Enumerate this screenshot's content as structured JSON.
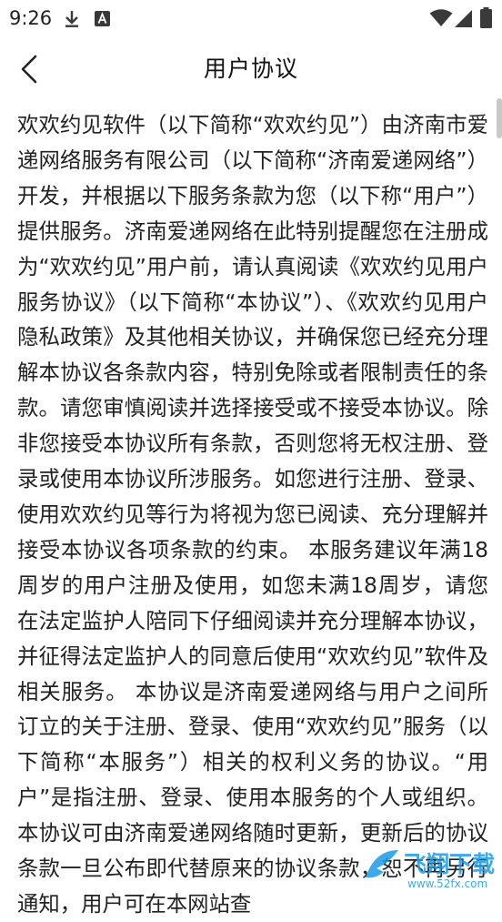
{
  "status_bar": {
    "time": "9:26",
    "icons": [
      "download-icon",
      "notification-a-icon",
      "wifi-icon",
      "signal-icon",
      "battery-icon"
    ]
  },
  "header": {
    "title": "用户协议",
    "back_icon": "back-arrow-icon"
  },
  "content": {
    "text": "欢欢约见软件（以下简称“欢欢约见”）由济南市爱递网络服务有限公司（以下简称“济南爱递网络”）开发，并根据以下服务条款为您（以下称“用户”）提供服务。济南爱递网络在此特别提醒您在注册成为“欢欢约见”用户前，请认真阅读《欢欢约见用户服务协议》（以下简称“本协议”）、《欢欢约见用户隐私政策》及其他相关协议，并确保您已经充分理解本协议各条款内容，特别免除或者限制责任的条款。请您审慎阅读并选择接受或不接受本协议。除非您接受本协议所有条款，否则您将无权注册、登录或使用本协议所涉服务。如您进行注册、登录、使用欢欢约见等行为将视为您已阅读、充分理解并接受本协议各项条款的约束。 本服务建议年满18周岁的用户注册及使用，如您未满18周岁，请您在法定监护人陪同下仔细阅读并充分理解本协议，并征得法定监护人的同意后使用“欢欢约见”软件及相关服务。 本协议是济南爱递网络与用户之间所订立的关于注册、登录、使用“欢欢约见”服务（以下简称“本服务”）相关的权利义务的协议。“用户”是指注册、登录、使用本服务的个人或组织。本协议可由济南爱递网络随时更新，更新后的协议条款一旦公布即代替原来的协议条款，恕不再另行通知，用户可在本网站查"
  },
  "watermark": {
    "label": "飞翔下载",
    "subtitle": "www.52fx.com"
  },
  "colors": {
    "background": "#ffffff",
    "text": "#222222",
    "status_icons": "#3a3a3a",
    "scrollbar": "#c9c9c9",
    "watermark": "#1a9be8"
  }
}
